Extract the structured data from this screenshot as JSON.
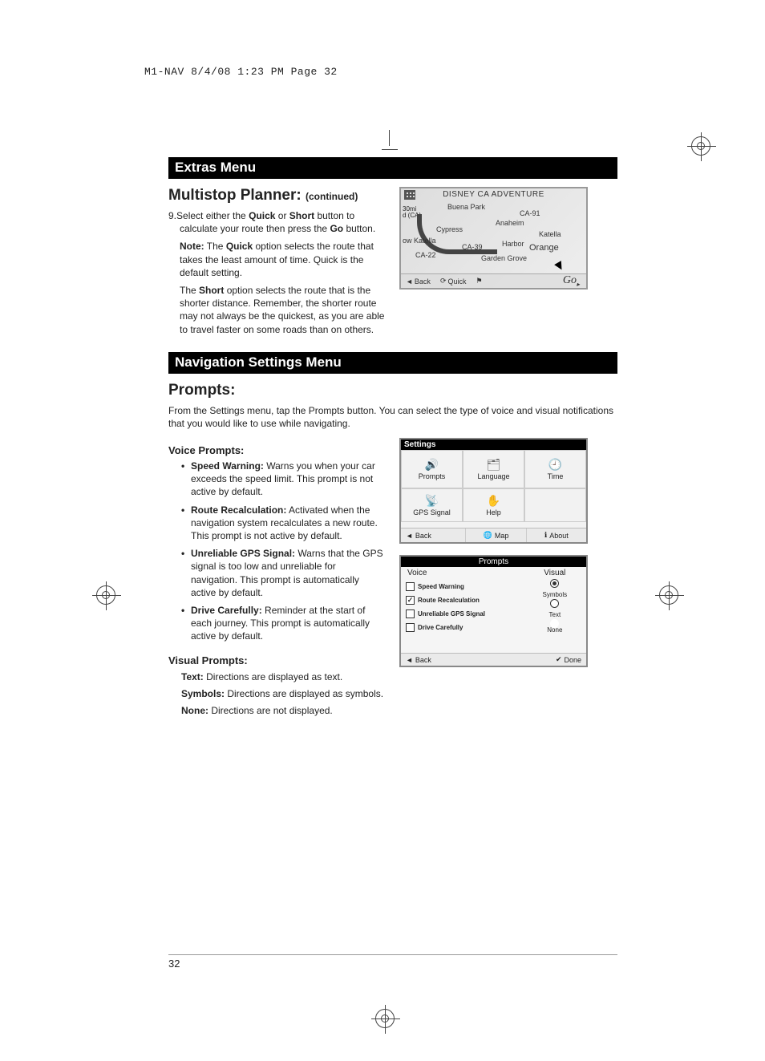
{
  "slug": "M1-NAV  8/4/08  1:23 PM  Page 32",
  "page_number": "32",
  "section1_bar": "Extras Menu",
  "section1_heading": "Multistop Planner:",
  "section1_heading_cont": "(continued)",
  "step9": {
    "num": "9.",
    "text_pre": "Select either the ",
    "quick": "Quick",
    "text_mid1": " or ",
    "short": "Short",
    "text_mid2": " button to calculate your route then press the ",
    "go": "Go",
    "text_end": " button."
  },
  "note1": {
    "label": "Note:",
    "text_pre": " The ",
    "quick": "Quick",
    "text_end": " option selects the route that takes the least amount of time. Quick is the default setting."
  },
  "note2": {
    "text_pre": "The ",
    "short": "Short",
    "text_end": " option selects the route that is the shorter distance. Remember, the shorter route may not always be the quickest, as you are able to travel faster on some roads than on others."
  },
  "map": {
    "title": "DISNEY CA ADVENTURE",
    "scale1": "30mi",
    "scale2": "d (CA)",
    "labels": {
      "buena": "Buena Park",
      "cypress": "Cypress",
      "katella": "ow Katella",
      "ca22": "CA-22",
      "ca39": "CA-39",
      "ca91": "CA-91",
      "anaheim": "Anaheim",
      "harbor": "Harbor",
      "orange": "Orange",
      "garden": "Garden Grove",
      "skatella": "Katella"
    },
    "btn_back": "Back",
    "btn_quick": "Quick",
    "btn_go": "Go"
  },
  "section2_bar": "Navigation Settings Menu",
  "section2_heading": "Prompts:",
  "section2_intro": "From the Settings menu, tap the Prompts button. You can select the type of voice and visual notifications that you would like to use while navigating.",
  "voice_heading": "Voice Prompts:",
  "voice_items": [
    {
      "term": "Speed Warning:",
      "text": " Warns you when your car exceeds the speed limit. This prompt is not active by default."
    },
    {
      "term": "Route Recalculation:",
      "text": " Activated when the navigation system recalculates a new route. This prompt is not active by default."
    },
    {
      "term": "Unreliable GPS Signal:",
      "text": " Warns that the GPS signal is too low and unreliable for navigation. This prompt is automatically active by default."
    },
    {
      "term": "Drive Carefully:",
      "text": " Reminder at the start of each journey. This prompt is automatically active by default."
    }
  ],
  "visual_heading": "Visual Prompts:",
  "visual_items": [
    {
      "term": "Text:",
      "text": " Directions are displayed as text."
    },
    {
      "term": "Symbols:",
      "text": " Directions are displayed as symbols."
    },
    {
      "term": "None:",
      "text": " Directions are not displayed."
    }
  ],
  "settings": {
    "hdr": "Settings",
    "cells": [
      "Prompts",
      "Language",
      "Time",
      "GPS Signal",
      "Help",
      ""
    ],
    "footer": [
      "Back",
      "Map",
      "About"
    ]
  },
  "prompts": {
    "hdr": "Prompts",
    "voice_label": "Voice",
    "rows": [
      {
        "checked": false,
        "label": "Speed Warning"
      },
      {
        "checked": true,
        "label": "Route Recalculation"
      },
      {
        "checked": false,
        "label": "Unreliable GPS Signal"
      },
      {
        "checked": false,
        "label": "Drive Carefully"
      }
    ],
    "visual_label": "Visual",
    "radios": [
      {
        "label": "Symbols",
        "sel": true
      },
      {
        "label": "Text",
        "sel": false
      },
      {
        "label": "None",
        "sel": false
      }
    ],
    "footer_back": "Back",
    "footer_done": "Done"
  }
}
